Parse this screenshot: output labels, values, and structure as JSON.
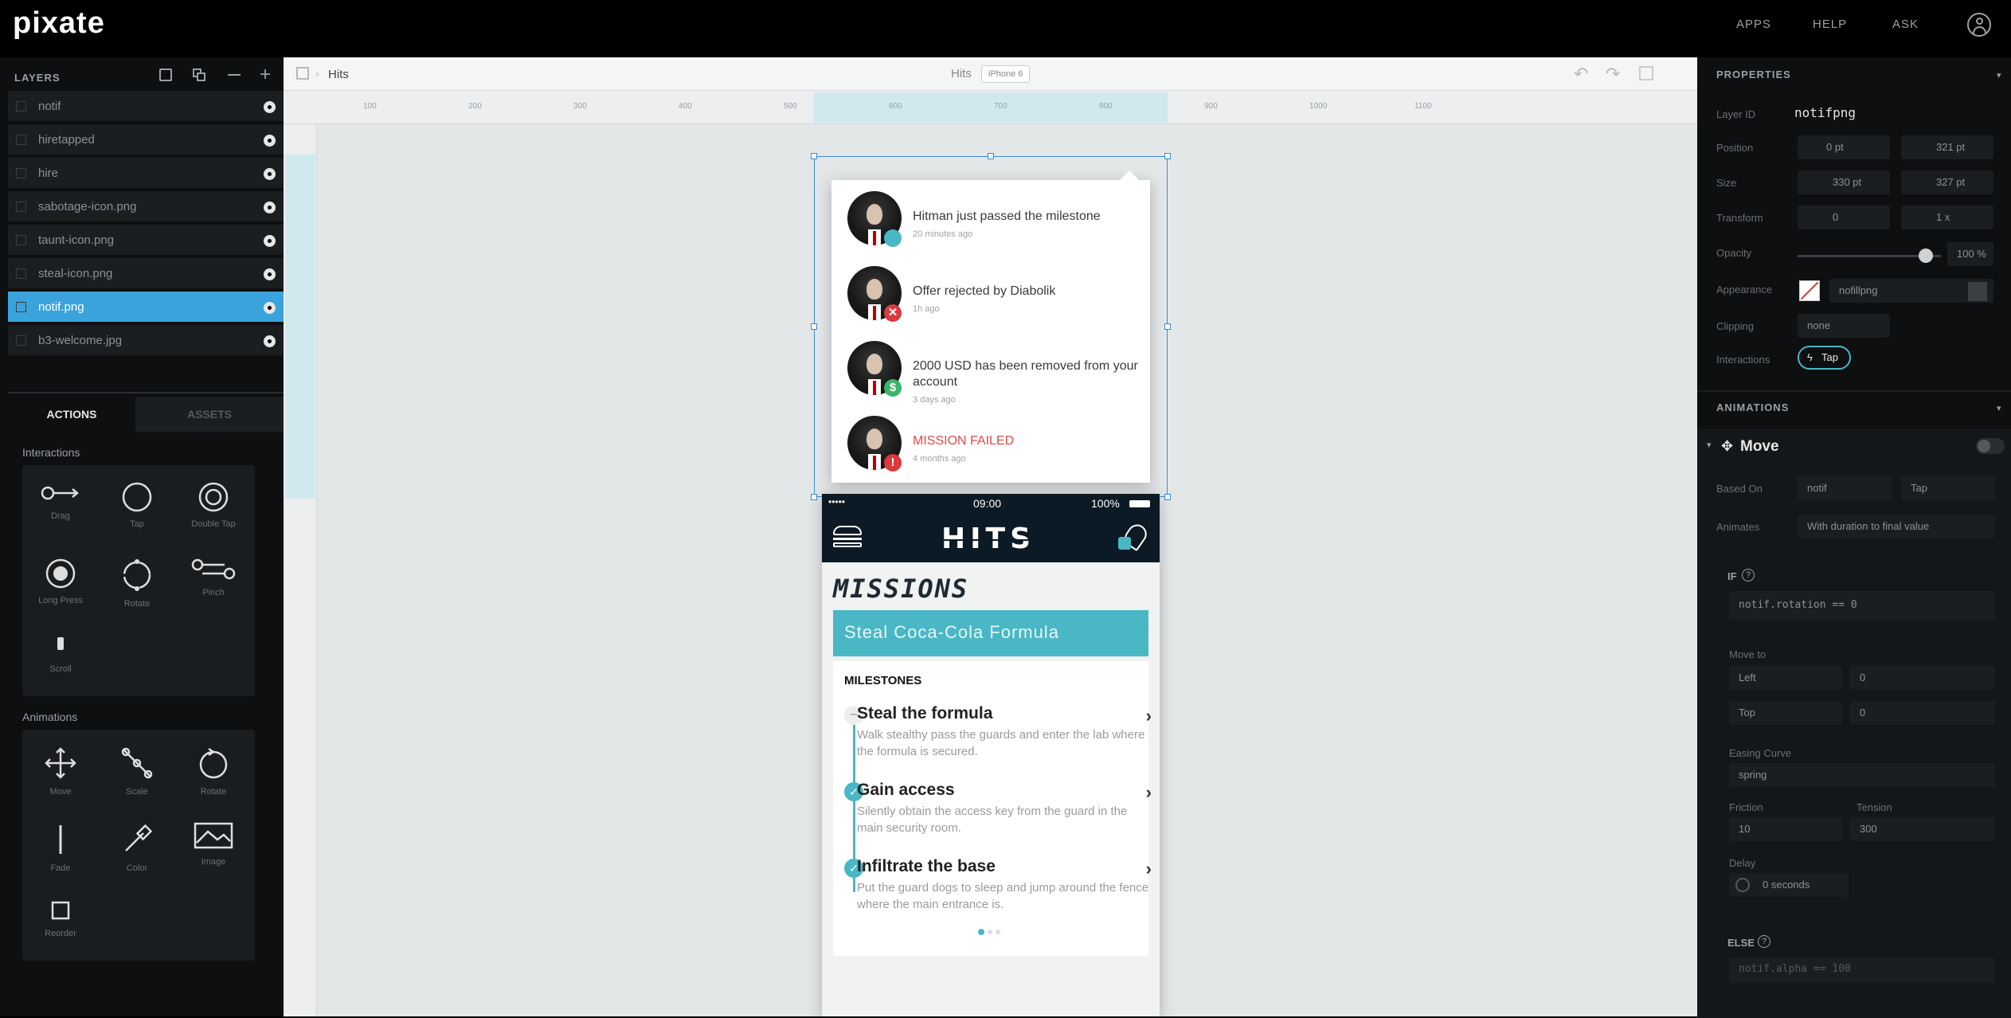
{
  "app": {
    "logo": "pixate",
    "nav": [
      "APPS",
      "HELP",
      "ASK"
    ]
  },
  "layers": {
    "title": "LAYERS",
    "items": [
      {
        "label": "notif",
        "selected": false
      },
      {
        "label": "hiretapped",
        "selected": false
      },
      {
        "label": "hire",
        "selected": false
      },
      {
        "label": "sabotage-icon.png",
        "selected": false
      },
      {
        "label": "taunt-icon.png",
        "selected": false
      },
      {
        "label": "steal-icon.png",
        "selected": false
      },
      {
        "label": "notif.png",
        "selected": true
      },
      {
        "label": "b3-welcome.jpg",
        "selected": false
      }
    ]
  },
  "actions": {
    "tabs": [
      "ACTIONS",
      "ASSETS"
    ],
    "interactions_title": "Interactions",
    "interactions": [
      {
        "label": "Drag",
        "icon": "drag-icon"
      },
      {
        "label": "Tap",
        "icon": "tap-icon"
      },
      {
        "label": "Double Tap",
        "icon": "double-tap-icon"
      },
      {
        "label": "Long Press",
        "icon": "long-press-icon"
      },
      {
        "label": "Rotate",
        "icon": "rotate-icon"
      },
      {
        "label": "Pinch",
        "icon": "pinch-icon"
      },
      {
        "label": "Scroll",
        "icon": "scroll-icon"
      }
    ],
    "animations_title": "Animations",
    "animations": [
      {
        "label": "Move",
        "icon": "move-icon"
      },
      {
        "label": "Scale",
        "icon": "scale-icon"
      },
      {
        "label": "Rotate",
        "icon": "rotate-anim-icon"
      },
      {
        "label": "Fade",
        "icon": "fade-icon"
      },
      {
        "label": "Color",
        "icon": "color-icon"
      },
      {
        "label": "Image",
        "icon": "image-icon"
      },
      {
        "label": "Reorder",
        "icon": "reorder-icon"
      }
    ]
  },
  "canvas": {
    "breadcrumb": "Hits",
    "device_label": "Hits",
    "device_badge": "iPhone 6",
    "ruler_marks": [
      "100",
      "200",
      "300",
      "400",
      "500",
      "600",
      "700",
      "800",
      "900",
      "1000",
      "1100"
    ]
  },
  "notifications": [
    {
      "text": "Hitman just passed the milestone",
      "time": "20 minutes ago",
      "badge": "",
      "badge_color": "#4ab7c5",
      "alert": false
    },
    {
      "text": "Offer rejected by Diabolik",
      "time": "1h ago",
      "badge": "✕",
      "badge_color": "#d93a3a",
      "alert": false
    },
    {
      "text": "2000 USD has been removed from your account",
      "time": "3 days ago",
      "badge": "$",
      "badge_color": "#3bb36b",
      "alert": false
    },
    {
      "text": "MISSION FAILED",
      "time": "4 months ago",
      "badge": "!",
      "badge_color": "#d93a3a",
      "alert": true
    }
  ],
  "phone": {
    "status_left": "•••••",
    "status_time": "09:00",
    "status_battery": "100%",
    "app_title": "HITS",
    "missions_title": "MISSIONS",
    "mission_banner": "Steal Coca-Cola Formula",
    "milestones_title": "MILESTONES",
    "milestones": [
      {
        "title": "Steal the formula",
        "desc": "Walk stealthy pass the guards and enter the lab where the formula is secured.",
        "done": false
      },
      {
        "title": "Gain access",
        "desc": "Silently obtain the access key from the guard in the main security room.",
        "done": true
      },
      {
        "title": "Infiltrate the base",
        "desc": "Put the guard dogs to sleep and jump around the fence where the main entrance is.",
        "done": true
      }
    ],
    "accent": "#4ab7c5"
  },
  "properties": {
    "title": "PROPERTIES",
    "layer_id_label": "Layer ID",
    "layer_id": "notifpng",
    "position_label": "Position",
    "position": [
      "0 pt",
      "321 pt"
    ],
    "size_label": "Size",
    "size": [
      "330 pt",
      "327 pt"
    ],
    "transform_label": "Transform",
    "transform": [
      "0",
      "1 x"
    ],
    "opacity_label": "Opacity",
    "opacity": "100 %",
    "appearance_label": "Appearance",
    "appearance_value": "nofillpng",
    "clipping_label": "Clipping",
    "clipping_value": "none",
    "interactions_label": "Interactions",
    "interaction_chip": "Tap"
  },
  "animations_panel": {
    "title": "ANIMATIONS",
    "anim_name": "Move",
    "based_on_label": "Based On",
    "based_on": [
      "notif",
      "Tap"
    ],
    "animates_label": "Animates",
    "animates_value": "With duration to final value",
    "if_label": "IF",
    "if_expr": "notif.rotation == 0",
    "move_to_label": "Move to",
    "move_rows": [
      [
        "Left",
        "0"
      ],
      [
        "Top",
        "0"
      ]
    ],
    "easing_label": "Easing Curve",
    "easing_value": "spring",
    "friction_label": "Friction",
    "friction_value": "10",
    "tension_label": "Tension",
    "tension_value": "300",
    "delay_label": "Delay",
    "delay_value": "0 seconds",
    "else_label": "ELSE",
    "else_expr": "notif.alpha == 100"
  }
}
